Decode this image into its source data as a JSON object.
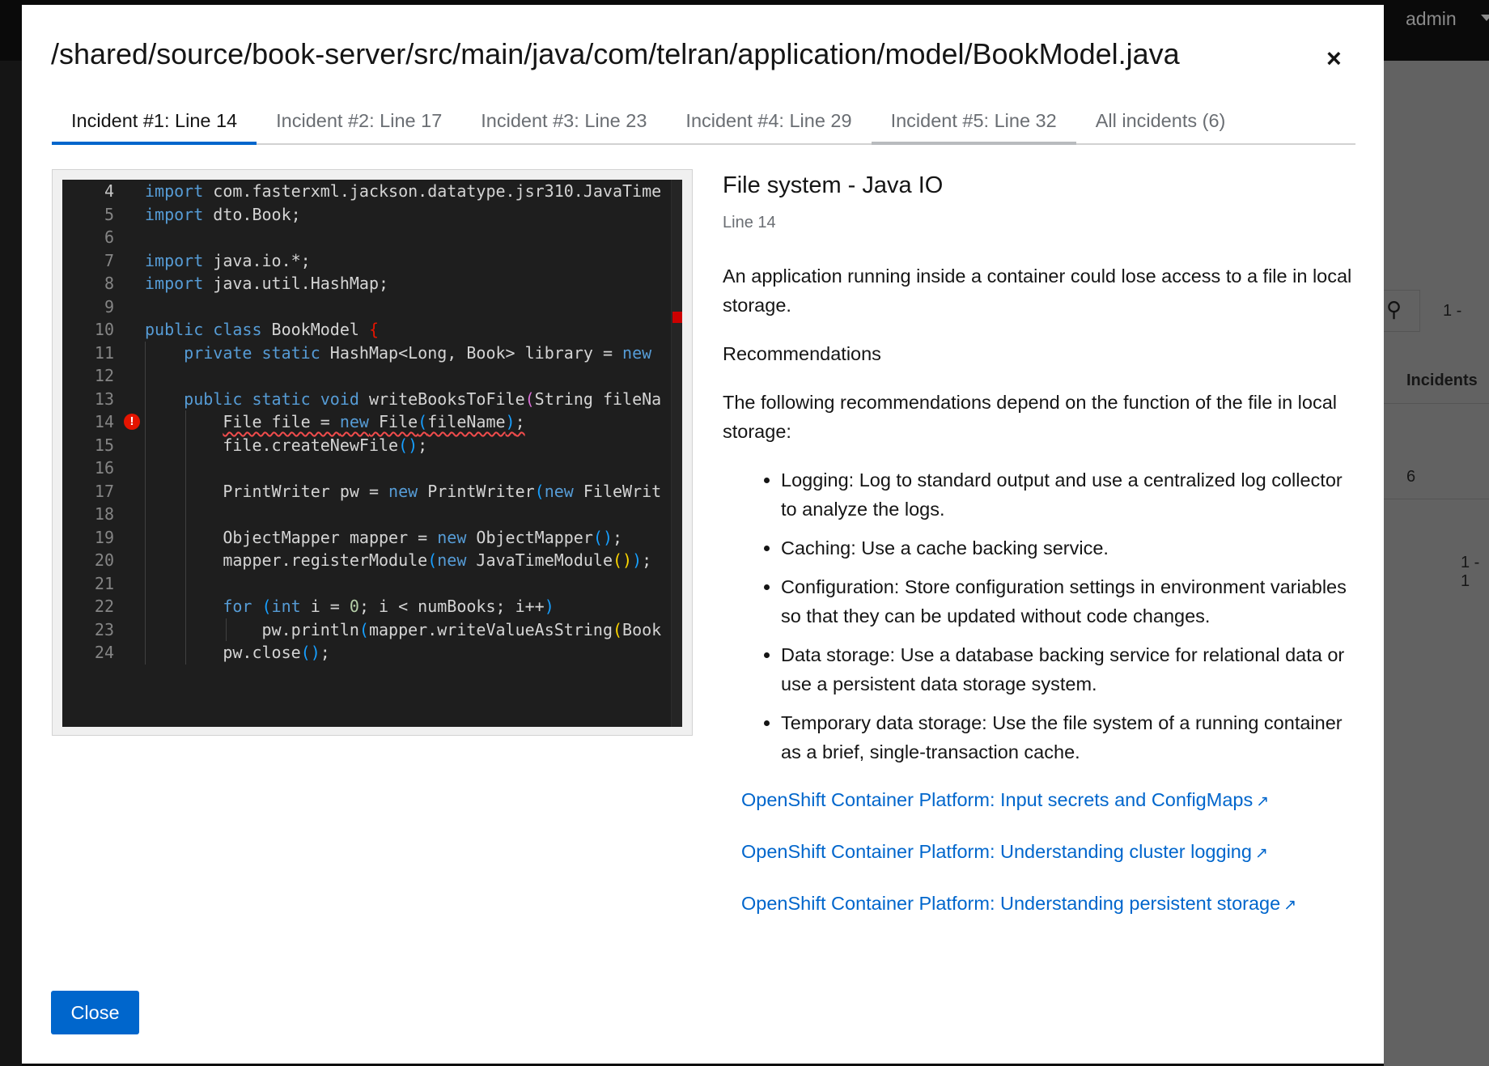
{
  "background": {
    "user": "admin",
    "search_icon": "search-icon",
    "pagination_top": "1 -",
    "column_header": "Incidents",
    "incident_count": "6",
    "pagination_bottom": "1 - 1"
  },
  "modal": {
    "title": "/shared/source/book-server/src/main/java/com/telran/application/model/BookModel.java",
    "tabs": [
      {
        "label": "Incident #1: Line 14"
      },
      {
        "label": "Incident #2: Line 17"
      },
      {
        "label": "Incident #3: Line 23"
      },
      {
        "label": "Incident #4: Line 29"
      },
      {
        "label": "Incident #5: Line 32"
      },
      {
        "label": "All incidents (6)"
      }
    ],
    "code": {
      "line_numbers": [
        "4",
        "5",
        "6",
        "7",
        "8",
        "9",
        "10",
        "11",
        "12",
        "13",
        "14",
        "15",
        "16",
        "17",
        "18",
        "19",
        "20",
        "21",
        "22",
        "23",
        "24"
      ],
      "error_line": "14"
    },
    "detail": {
      "heading": "File system - Java IO",
      "line": "Line 14",
      "description": "An application running inside a container could lose access to a file in local storage.",
      "recommendations_label": "Recommendations",
      "intro": "The following recommendations depend on the function of the file in local storage:",
      "bullets": [
        "Logging: Log to standard output and use a centralized log collector to analyze the logs.",
        "Caching: Use a cache backing service.",
        "Configuration: Store configuration settings in environment variables so that they can be updated without code changes.",
        "Data storage: Use a database backing service for relational data or use a persistent data storage system.",
        "Temporary data storage: Use the file system of a running container as a brief, single-transaction cache."
      ],
      "links": [
        "OpenShift Container Platform: Input secrets and ConfigMaps",
        "OpenShift Container Platform: Understanding cluster logging",
        "OpenShift Container Platform: Understanding persistent storage"
      ]
    },
    "close_label": "Close",
    "close_icon": "×",
    "accent": "#0066cc"
  }
}
